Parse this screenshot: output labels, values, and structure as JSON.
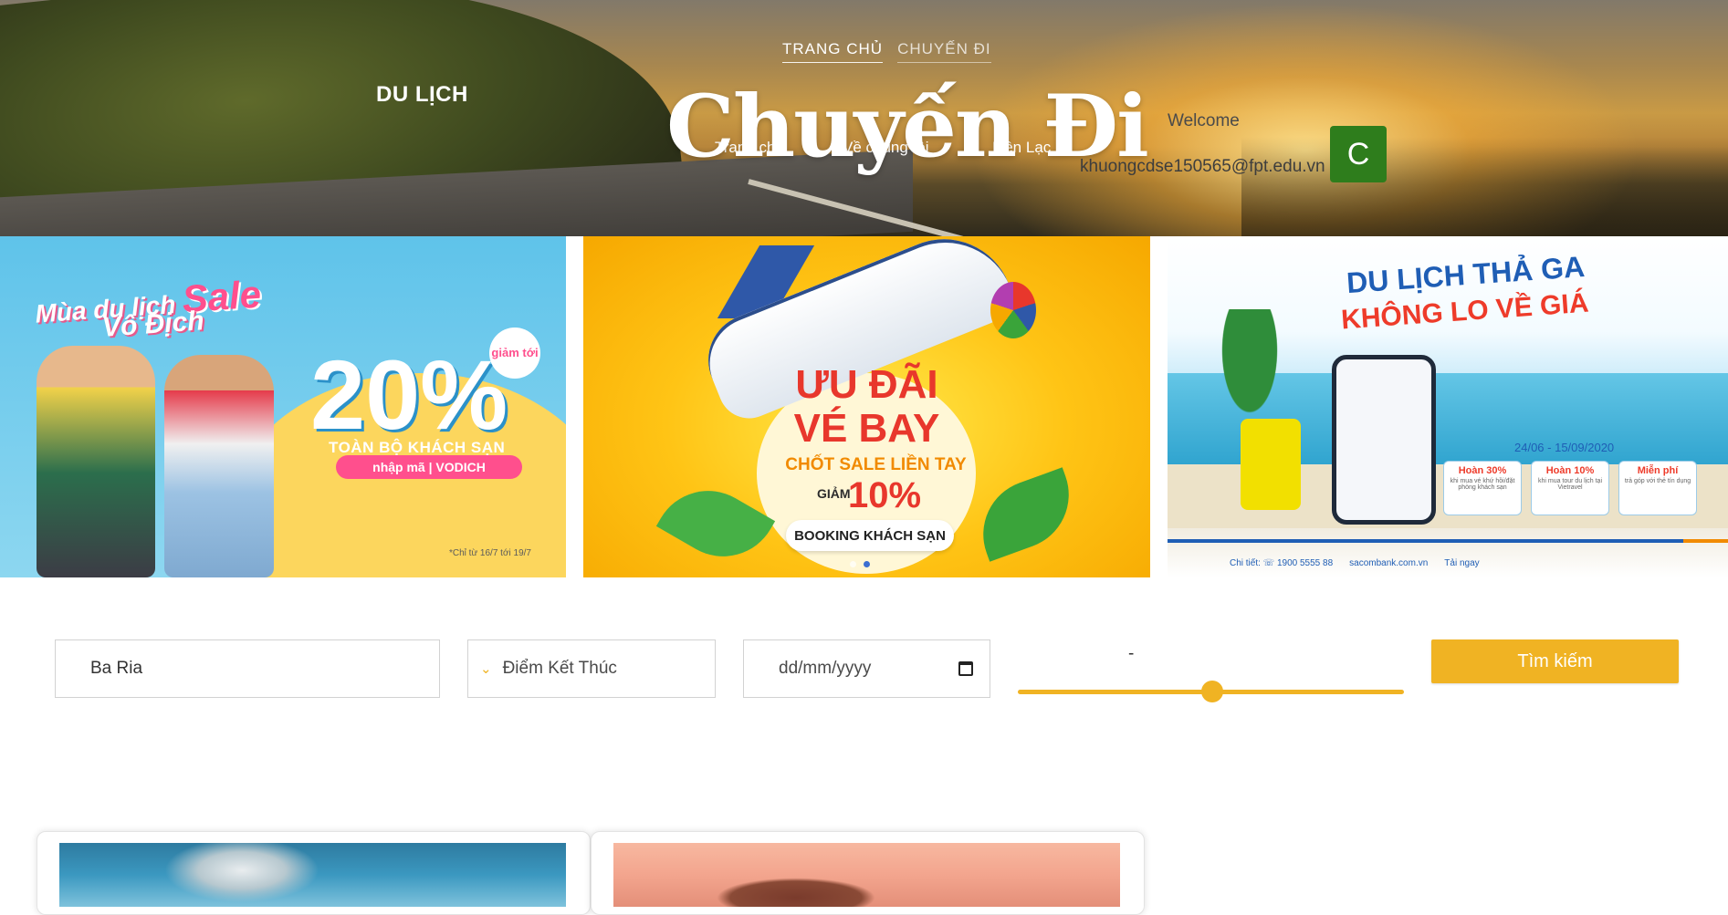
{
  "header": {
    "brand": "DU LỊCH",
    "top_nav": [
      {
        "label": "TRANG CHỦ"
      },
      {
        "label": "CHUYẾN ĐI"
      }
    ],
    "sub_nav": [
      {
        "label": "Trang chủ"
      },
      {
        "label": "Về chúng tôi"
      },
      {
        "label": "Liên Lạc"
      }
    ],
    "page_title": "Chuyến Đi",
    "welcome": "Welcome",
    "user_email": "khuongcdse150565@fpt.edu.vn",
    "avatar_letter": "C",
    "avatar_color": "#2e7d1c"
  },
  "banners": {
    "b1": {
      "title_a": "Mùa du lịch",
      "title_sale": "Sale",
      "title_b": "Vô Địch",
      "badge": "giảm tới",
      "percent": "20%",
      "subtitle": "TOÀN BỘ KHÁCH SẠN",
      "code": "nhập mã  |  VODICH",
      "note": "*Chỉ từ 16/7 tới 19/7"
    },
    "b2": {
      "line1": "ƯU ĐÃI",
      "line2": "VÉ BAY",
      "line3": "CHỐT SALE LIỀN TAY",
      "giam": "GIẢM",
      "percent": "10%",
      "pill": "BOOKING KHÁCH SẠN"
    },
    "b3": {
      "line1": "DU LỊCH THẢ GA",
      "line2": "KHÔNG LO VỀ GIÁ",
      "date_range": "24/06 - 15/09/2020",
      "box1_title": "Hoàn 30%",
      "box1_text": "khi mua vé khứ hồi/đặt phòng khách sạn",
      "box2_title": "Hoàn 10%",
      "box2_text": "khi mua tour du lịch tại Vietravel",
      "box3_title": "Miễn phí",
      "box3_text": "trả góp với thẻ tín dụng",
      "foot_detail": "Chi tiết: ☏ 1900 5555 88",
      "foot_site": "sacombank.com.vn",
      "foot_app": "Tải  ngay"
    },
    "carousel_dots": 2,
    "carousel_active": 1
  },
  "search": {
    "start_value": "Ba Ria",
    "end_placeholder": "Điểm Kết Thúc",
    "date_placeholder": "dd/mm/yyyy",
    "range_label": "-",
    "range_value_fraction": 0.5,
    "button_label": "Tìm kiếm",
    "accent_color": "#f0b323"
  },
  "cards": [
    {
      "image": "ocean-image"
    },
    {
      "image": "sunset-rock-image"
    }
  ]
}
